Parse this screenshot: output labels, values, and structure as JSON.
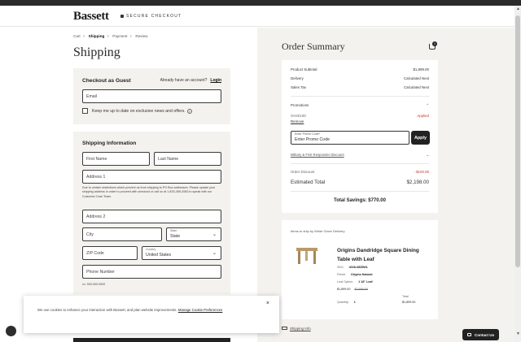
{
  "header": {
    "logo": "Bassett",
    "secure_text": "SECURE CHECKOUT"
  },
  "breadcrumb": {
    "items": [
      "Cart",
      "Shipping",
      "Payment",
      "Review"
    ],
    "separator": ">"
  },
  "page_title": "Shipping",
  "guest": {
    "title": "Checkout as Guest",
    "account_prompt": "Already have an account?",
    "login_label": "Login",
    "email_placeholder": "Email",
    "newsletter_label": "Keep me up to date on exclusive news and offers."
  },
  "shipping_info": {
    "title": "Shipping Information",
    "first_name": "First Name",
    "last_name": "Last Name",
    "address1": "Address 1",
    "notice": "Due to certain restrictions which prevent us from shipping to PO Box addresses. Please update your shipping address in order to proceed with checkout or call us at 1-833-459-2083 to speak with our Customer Care Team.",
    "address2": "Address 2",
    "city": "City",
    "state_label": "State",
    "state_value": "State",
    "zip": "ZIP Code",
    "country_label": "Country",
    "country_value": "United States",
    "phone": "Phone Number",
    "phone_hint": "ex: 555-555-5555"
  },
  "order_summary": {
    "title": "Order Summary",
    "cart_count": "1",
    "product_subtotal_label": "Product Subtotal",
    "product_subtotal_value": "$1,899.00",
    "delivery_label": "Delivery",
    "delivery_value": "Calculated Next",
    "sales_tax_label": "Sales Tax",
    "sales_tax_value": "Calculated Next",
    "promotions_label": "Promotions",
    "promo_code": "SAVE100",
    "promo_remove": "Remove",
    "promo_status": "Applied",
    "promo_input_label": "Enter Promo Code*",
    "promo_input_value": "Enter Promo Code",
    "apply_label": "Apply",
    "military_label": "Military & First Responder Discount",
    "order_discount_label": "Order Discount",
    "order_discount_value": "- $100.00",
    "estimated_total_label": "Estimated Total",
    "estimated_total_value": "$2,198.00",
    "total_savings": "Total Savings: $770.00"
  },
  "item": {
    "ship_header": "Items to ship by White Glove Delivery",
    "name": "Origins Dandridge Square Dining Table with Leaf",
    "sku_label": "SKU:",
    "sku_value": "4028-3835WL",
    "finish_label": "Finish:",
    "finish_value": "Origins Natural",
    "leaf_label": "Leaf Option:",
    "leaf_value": "1 18\" Leaf",
    "price": "$1,899.00",
    "was_price": "$2,669.00",
    "qty_label": "Quantity:",
    "qty_value": "1",
    "total_label": "Total",
    "total_value": "$1,899.00"
  },
  "shipping_link": "Shipping Info",
  "cookie": {
    "text": "We use cookies to enhance your interaction with Bassett, and plan website improvements.",
    "link": "Manage Cookie Preferences",
    "close": "×"
  },
  "contact_label": "Contact Us"
}
